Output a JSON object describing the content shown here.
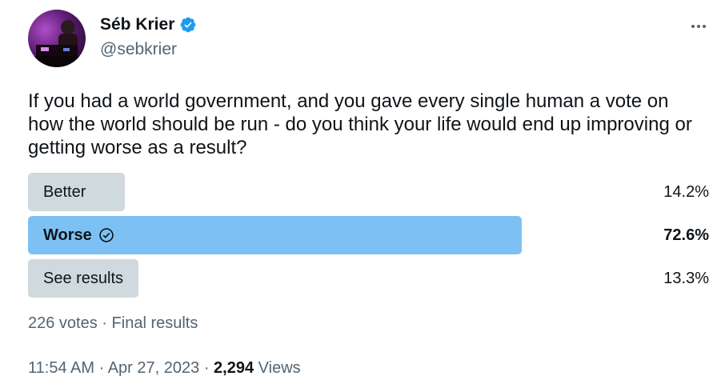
{
  "author": {
    "display_name": "Séb Krier",
    "handle": "@sebkrier",
    "verified_color": "#1d9bf0"
  },
  "tweet": {
    "text": "If you had a world government, and you gave every single human a vote on how the world should be run - do you think your life would end up improving or getting worse as a result?"
  },
  "poll": {
    "options": [
      {
        "label": "Better",
        "percent_text": "14.2%",
        "percent": 14.2,
        "winner": false
      },
      {
        "label": "Worse",
        "percent_text": "72.6%",
        "percent": 72.6,
        "winner": true
      },
      {
        "label": "See results",
        "percent_text": "13.3%",
        "percent": 13.3,
        "winner": false
      }
    ],
    "votes": "226 votes",
    "separator": "·",
    "status": "Final results"
  },
  "meta": {
    "time": "11:54 AM",
    "separator": "·",
    "date": "Apr 27, 2023",
    "views_count": "2,294",
    "views_label": "Views"
  },
  "icons": {
    "more": "more-horizontal-icon",
    "verified": "verified-badge-icon",
    "check": "check-circle-icon"
  }
}
